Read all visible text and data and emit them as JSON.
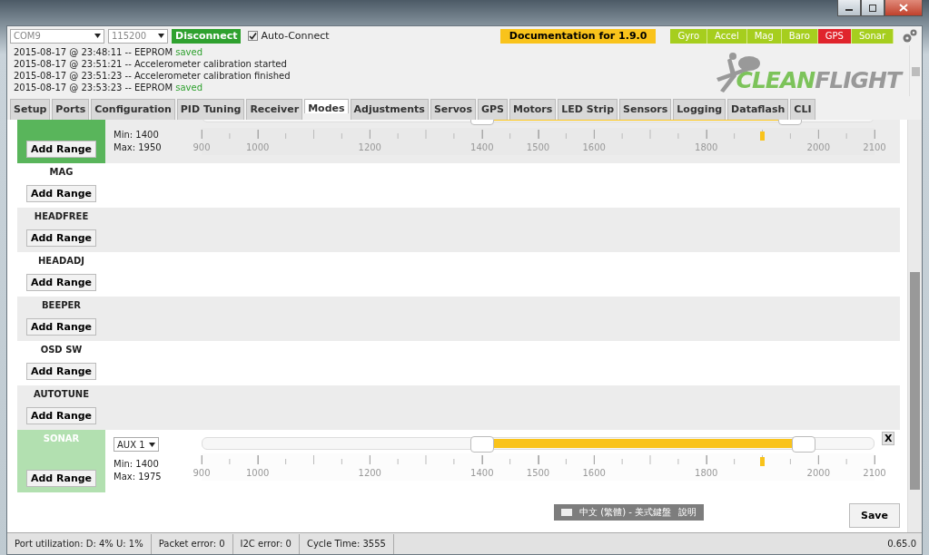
{
  "toolbar": {
    "port": "COM9",
    "baud": "115200",
    "connect_button": "Disconnect",
    "auto_connect": {
      "label": "Auto-Connect",
      "checked": true
    },
    "docs_button": "Documentation for 1.9.0",
    "sensors": [
      {
        "label": "Gyro",
        "color": "#a6ce1e"
      },
      {
        "label": "Accel",
        "color": "#a6ce1e"
      },
      {
        "label": "Mag",
        "color": "#a6ce1e"
      },
      {
        "label": "Baro",
        "color": "#a6ce1e"
      },
      {
        "label": "GPS",
        "color": "#e0242c"
      },
      {
        "label": "Sonar",
        "color": "#a6ce1e"
      }
    ]
  },
  "log": [
    {
      "text": "2015-08-17 @ 23:48:11 -- EEPROM ",
      "status": "saved"
    },
    {
      "text": "2015-08-17 @ 23:51:21 -- Accelerometer calibration started"
    },
    {
      "text": "2015-08-17 @ 23:51:23 -- Accelerometer calibration finished"
    },
    {
      "text": "2015-08-17 @ 23:53:23 -- EEPROM ",
      "status": "saved"
    }
  ],
  "logo": {
    "left": "CLEAN",
    "right": "FLIGHT"
  },
  "tabs": [
    {
      "label": "Setup",
      "selected": false
    },
    {
      "label": "Ports",
      "selected": false
    },
    {
      "label": "Configuration",
      "selected": false
    },
    {
      "label": "PID Tuning",
      "selected": false
    },
    {
      "label": "Receiver",
      "selected": false
    },
    {
      "label": "Modes",
      "selected": true
    },
    {
      "label": "Adjustments",
      "selected": false
    },
    {
      "label": "Servos",
      "selected": false
    },
    {
      "label": "GPS",
      "selected": false
    },
    {
      "label": "Motors",
      "selected": false
    },
    {
      "label": "LED Strip",
      "selected": false
    },
    {
      "label": "Sensors",
      "selected": false
    },
    {
      "label": "Logging",
      "selected": false
    },
    {
      "label": "Dataflash",
      "selected": false
    },
    {
      "label": "CLI",
      "selected": false
    }
  ],
  "modes": [
    {
      "kind": "partial",
      "active": true,
      "button": "Add Range",
      "range": {
        "min": "Min: 1400",
        "max": "Max: 1950",
        "thumbs": [
          {
            "level": 0.4167
          },
          {
            "level": 0.875
          }
        ],
        "marker": {
          "level": 0.8333
        },
        "scale": [
          {
            "label": "900",
            "level": 0
          },
          {
            "label": "1000",
            "level": 0.0833
          },
          {
            "label": "1200",
            "level": 0.25
          },
          {
            "label": "1400",
            "level": 0.4167
          },
          {
            "label": "1500",
            "level": 0.5
          },
          {
            "label": "1600",
            "level": 0.5833
          },
          {
            "label": "1800",
            "level": 0.75
          },
          {
            "label": "2000",
            "level": 0.9167
          },
          {
            "label": "2100",
            "level": 1
          }
        ]
      }
    },
    {
      "kind": "empty",
      "name": "MAG",
      "active": false,
      "button": "Add Range"
    },
    {
      "kind": "empty",
      "name": "HEADFREE",
      "active": false,
      "button": "Add Range"
    },
    {
      "kind": "empty",
      "name": "HEADADJ",
      "active": false,
      "button": "Add Range"
    },
    {
      "kind": "empty",
      "name": "BEEPER",
      "active": false,
      "button": "Add Range"
    },
    {
      "kind": "empty",
      "name": "OSD SW",
      "active": false,
      "button": "Add Range"
    },
    {
      "kind": "empty",
      "name": "AUTOTUNE",
      "active": false,
      "button": "Add Range"
    },
    {
      "kind": "range",
      "name": "SONAR",
      "active": false,
      "button": "Add Range",
      "range": {
        "channel": "AUX 1",
        "min": "Min: 1400",
        "max": "Max: 1975",
        "remove": "X",
        "thumbs": [
          {
            "level": 0.4167
          },
          {
            "level": 0.8958
          }
        ],
        "marker": {
          "level": 0.8333
        },
        "scale": [
          {
            "label": "900",
            "level": 0
          },
          {
            "label": "1000",
            "level": 0.0833
          },
          {
            "label": "1200",
            "level": 0.25
          },
          {
            "label": "1400",
            "level": 0.4167
          },
          {
            "label": "1500",
            "level": 0.5
          },
          {
            "label": "1600",
            "level": 0.5833
          },
          {
            "label": "1800",
            "level": 0.75
          },
          {
            "label": "2000",
            "level": 0.9167
          },
          {
            "label": "2100",
            "level": 1
          }
        ]
      }
    }
  ],
  "language_bar": {
    "language": "中文 (繁體) - 美式鍵盤",
    "help": "說明"
  },
  "save_button": "Save",
  "status_bar": {
    "items": [
      "Port utilization: D: 4% U: 1%",
      "Packet error: 0",
      "I2C error: 0",
      "Cycle Time: 3555"
    ],
    "version": "0.65.0"
  }
}
